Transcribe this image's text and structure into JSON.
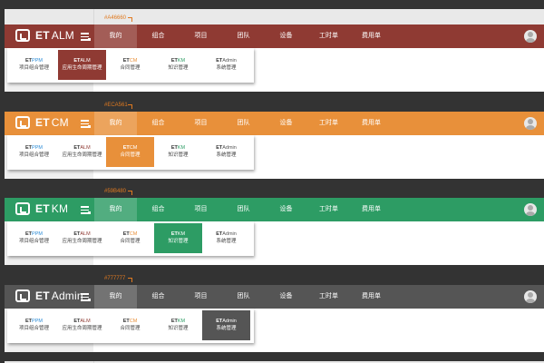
{
  "top_label": "360px",
  "nav": [
    "我的",
    "组合",
    "项目",
    "团队",
    "设备",
    "工时单",
    "费用单"
  ],
  "apps": [
    {
      "prefix": "ET",
      "name": "PPM",
      "desc": "项目组合管理",
      "color": "#2a8bd6"
    },
    {
      "prefix": "ET",
      "name": "ALM",
      "desc": "应用生命周期管理",
      "color": "#8f3a33"
    },
    {
      "prefix": "ET",
      "name": "CM",
      "desc": "合同管理",
      "color": "#e8903a"
    },
    {
      "prefix": "ET",
      "name": "KM",
      "desc": "知识管理",
      "color": "#2d9c64"
    },
    {
      "prefix": "ET",
      "name": "Admin",
      "desc": "系统管理",
      "color": "#555555"
    }
  ],
  "sections": [
    {
      "hex": "#A46660",
      "brand_prefix": "ET",
      "brand_name": "ALM",
      "color": "#8f3a33",
      "active_app": 1
    },
    {
      "hex": "#ECA561",
      "brand_prefix": "ET",
      "brand_name": "CM",
      "color": "#e8903a",
      "active_app": 2
    },
    {
      "hex": "#59B480",
      "brand_prefix": "ET",
      "brand_name": "KM",
      "color": "#2d9c64",
      "active_app": 3
    },
    {
      "hex": "#777777",
      "brand_prefix": "ET",
      "brand_name": "Admin",
      "color": "#555555",
      "active_app": 4
    }
  ],
  "icons": {
    "logo": "et-logo-icon",
    "menu": "menu-icon",
    "avatar": "user-avatar-icon"
  }
}
